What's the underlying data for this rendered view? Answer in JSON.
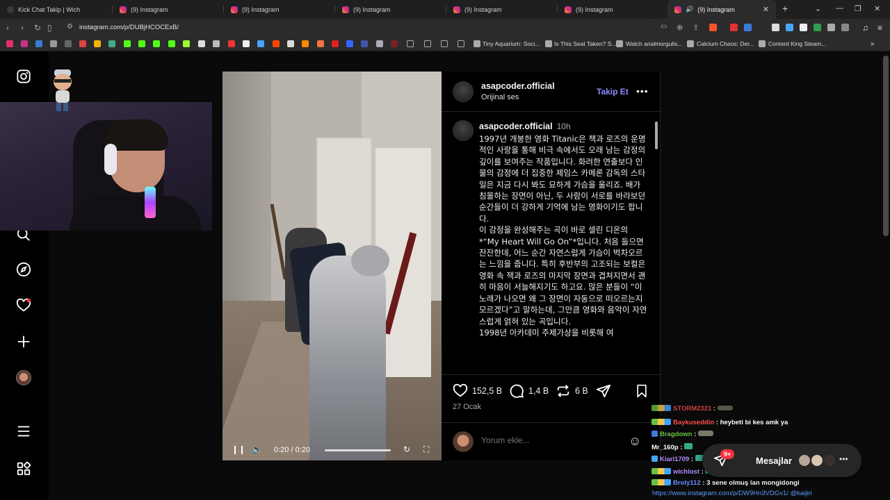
{
  "tabs": [
    {
      "title": "Kick Chat Takip | Wich",
      "type": "kick"
    },
    {
      "title": "(9) Instagram",
      "type": "instagram"
    },
    {
      "title": "(9) Instagram",
      "type": "instagram"
    },
    {
      "title": "(9) Instagram",
      "type": "instagram"
    },
    {
      "title": "(9) Instagram",
      "type": "instagram"
    },
    {
      "title": "(9) Instagram",
      "type": "instagram"
    },
    {
      "title": "(9) Instagram",
      "type": "instagram",
      "active": true
    }
  ],
  "address": {
    "url": "instagram.com/p/DUBjHCOCExB/"
  },
  "bookmarks": [
    {
      "label": "Tiny Aquarium: Soci..."
    },
    {
      "label": "Is This Seat Taken? S..."
    },
    {
      "label": "Watch analmorgulis..."
    },
    {
      "label": "Calcium Chaos: Der..."
    },
    {
      "label": "Content King Steam..."
    }
  ],
  "post": {
    "username": "asapcoder.official",
    "audio": "Orijinal ses",
    "follow": "Takip Et",
    "caption_user": "asapcoder.official",
    "caption_time": "10h",
    "caption": "1997년 개봉한 영화 Titanic은 책과 로즈의 운명적인 사랑을 통해 비극 속에서도 오래 남는 감정의 깊이를 보여주는 작품입니다. 화려한 연출보다 인물의 감정에 더 집중한 제임스 카메론 감독의 스타일은 지금 다시 봐도 묘하게 가슴을 울리죠. 배가 침몰하는 장면이 아닌, 두 사람이 서로를 바라보던 순간들이 더 강하게 기억에 남는 영화이기도 합니다.\n이 감정을 완성해주는 곡이 바로 셀린 디온의 *“My Heart Will Go On”*입니다. 처음 들으면 잔잔한데, 어느 순간 자연스럽게 가슴이 벅차오르는 느낌을 줍니다. 특히 후반부의 고조되는 보컬은 영화 속 잭과 로즈의 마지막 장면과 겹쳐지면서 괜히 마음이 서늘해지기도 하고요. 많은 분들이 “이 노래가 나오면 왜 그 장면이 자동으로 떠오르는지 모르겠다”고 말하는데, 그만큼 영화와 음악이 자연스럽게 얽혀 있는 곡입니다.\n1998년 아카데미 주제가상을 비롯해 여",
    "likes": "152,5 B",
    "comments": "1,4 B",
    "reposts": "6 B",
    "date": "27 Ocak",
    "comment_placeholder": "Yorum ekle..."
  },
  "video": {
    "time": "0:20 / 0:20",
    "progress": 1.0
  },
  "chat": [
    {
      "user": "STORM2321",
      "text": ""
    },
    {
      "user": "Baykuseddin",
      "text": "heybeti bi kes amk ya",
      "color": "#ff4d4d"
    },
    {
      "user": "Bragdown",
      "text": "",
      "color": "#6ac143"
    },
    {
      "user": "Mr_160p",
      "text": "",
      "color": "#ffffff"
    },
    {
      "user": "Kiari1709",
      "text": "",
      "color": "#b18cff"
    },
    {
      "user": "wichlost",
      "text": "",
      "color": "#b18cff"
    },
    {
      "user": "Broly112",
      "text": "3 sene olmuş lan mongidongi",
      "color": "#6b8cff"
    }
  ],
  "chat_link": "https://www.instagram.com/p/DW9Hn3VDGv1/ @kaijiri",
  "messages": {
    "label": "Mesajlar",
    "badge": "9+"
  }
}
